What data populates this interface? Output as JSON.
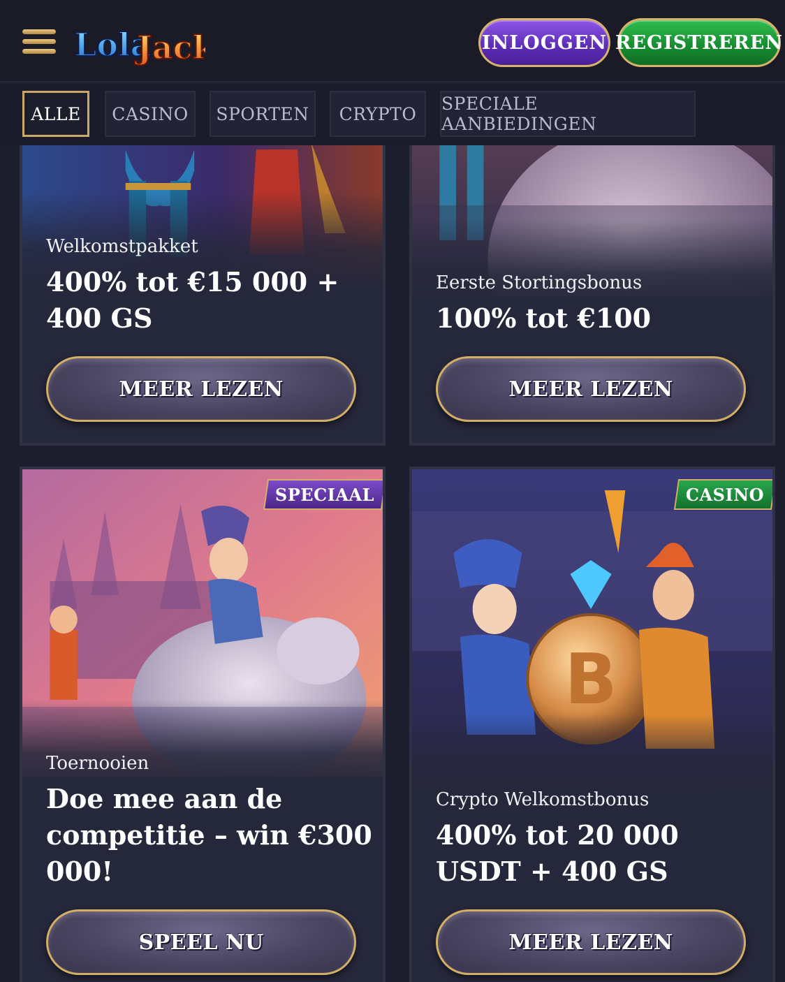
{
  "header": {
    "menu_icon": "hamburger-icon",
    "logo_text": "LolaJack",
    "login_label": "INLOGGEN",
    "register_label": "REGISTREREN"
  },
  "tabs": [
    {
      "label": "ALLE",
      "active": true
    },
    {
      "label": "CASINO",
      "active": false
    },
    {
      "label": "SPORTEN",
      "active": false
    },
    {
      "label": "CRYPTO",
      "active": false
    },
    {
      "label": "SPECIALE AANBIEDINGEN",
      "active": false
    }
  ],
  "cards": [
    {
      "subtitle": "Welkomstpakket",
      "title": "400% tot €15 000 + 400 GS",
      "button": "MEER LEZEN"
    },
    {
      "subtitle": "Eerste Stortingsbonus",
      "title": "100% tot €100",
      "button": "MEER LEZEN"
    },
    {
      "badge": "SPECIAAL",
      "subtitle": "Toernooien",
      "title": "Doe mee aan de competitie – win €300 000!",
      "button": "SPEEL NU"
    },
    {
      "badge": "CASINO",
      "subtitle": "Crypto Welkomstbonus",
      "title": "400% tot 20 000 USDT + 400 GS",
      "button": "MEER LEZEN"
    }
  ],
  "colors": {
    "background": "#1c1d2d",
    "gold_border": "#d3ae68",
    "login_purple": "#5b2cb4",
    "register_green": "#168a31"
  }
}
